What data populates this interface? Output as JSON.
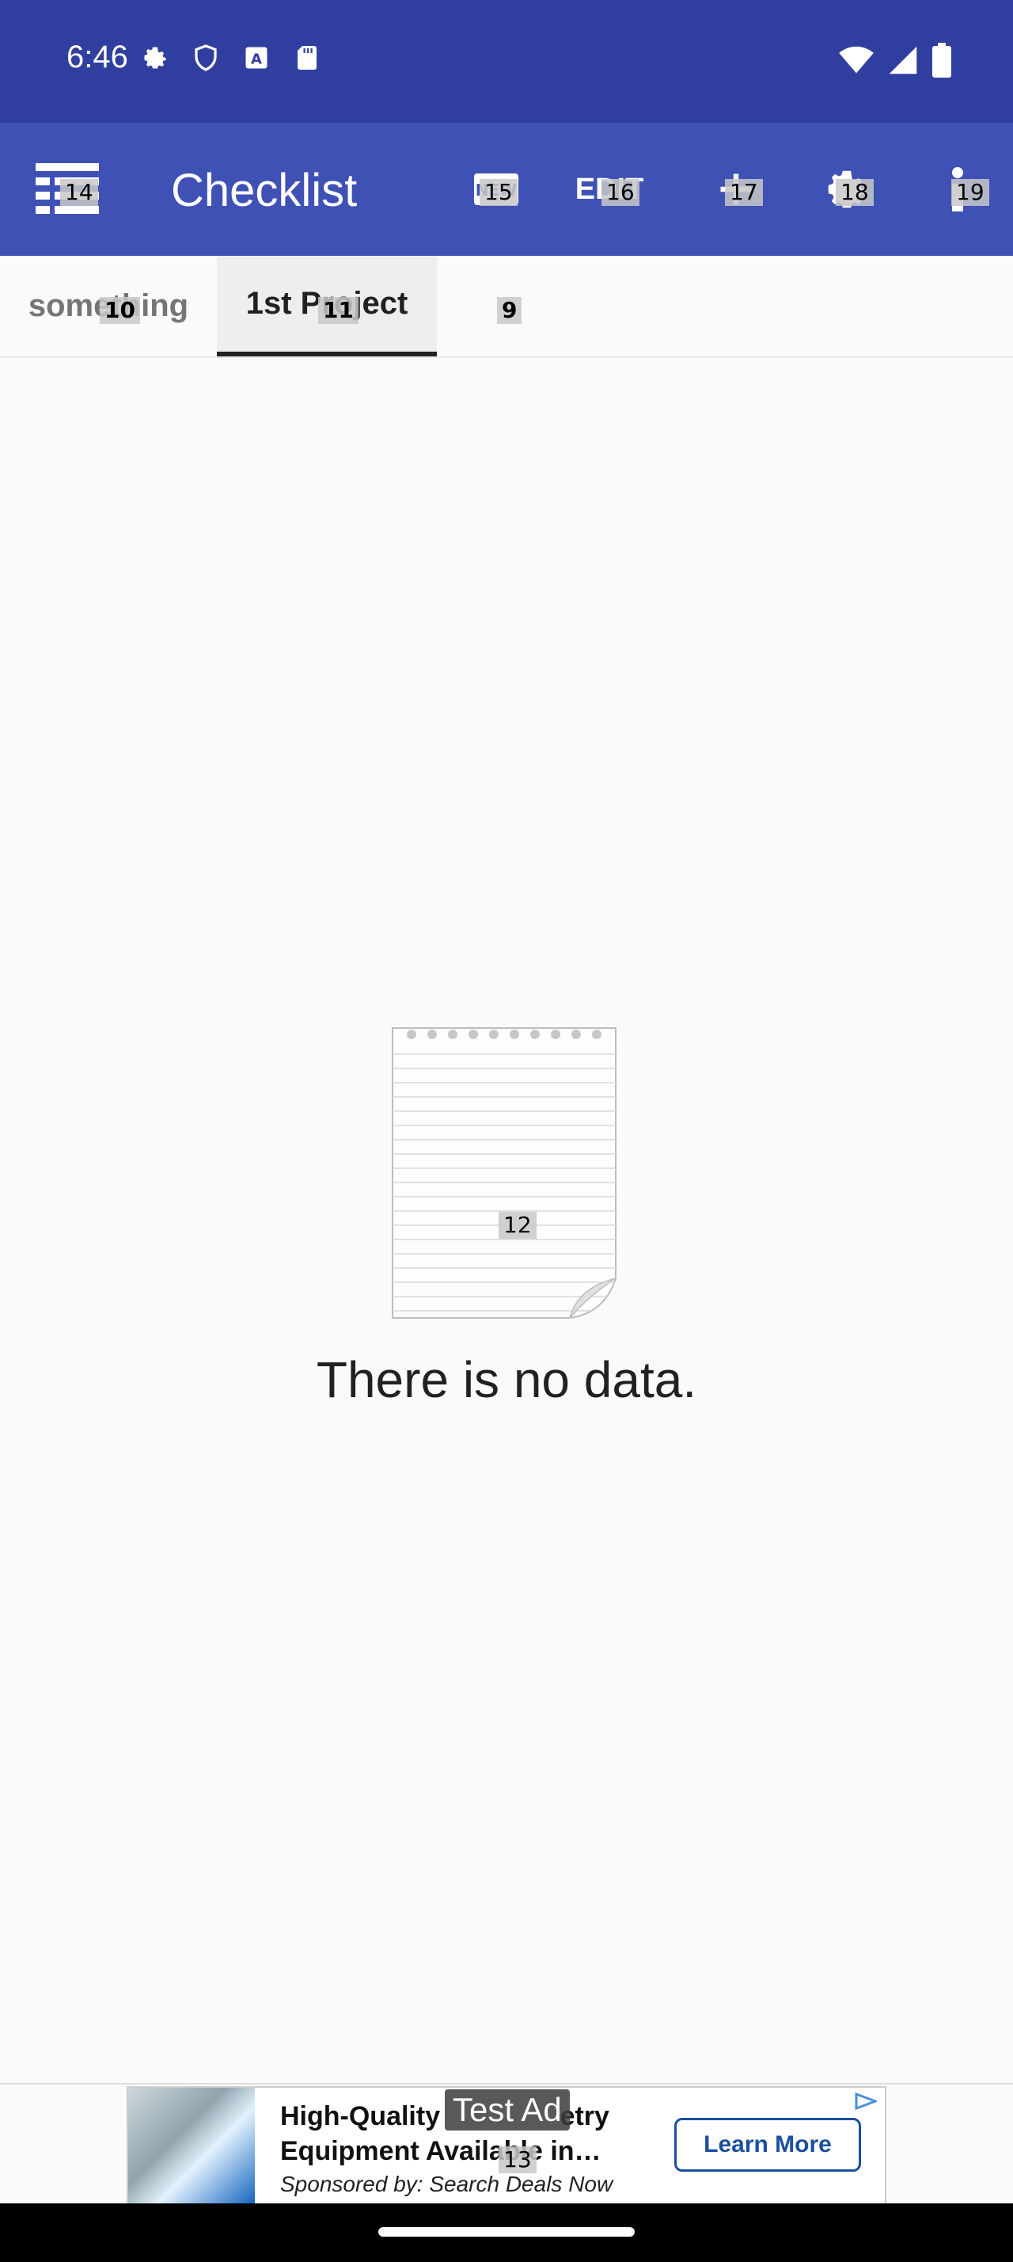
{
  "status_bar": {
    "time": "6:46"
  },
  "app_bar": {
    "title": "Checklist",
    "edit_label": "EDIT",
    "badges": {
      "menu": "14",
      "new": "15",
      "edit": "16",
      "add": "17",
      "settings": "18",
      "info": "19"
    }
  },
  "tabs": [
    {
      "label": "something",
      "badge": "10"
    },
    {
      "label": "1st Project",
      "badge": "11"
    },
    {
      "label": "",
      "badge": "9"
    }
  ],
  "empty_state": {
    "message": "There is no data.",
    "badge": "12"
  },
  "ad": {
    "title": "High-Quality Laboratory Equipment Available in…",
    "title_line1": "High-Quality",
    "title_line1b": "etry",
    "title_line2": "Equipment Available in…",
    "sponsor": "Sponsored by: Search Deals Now",
    "cta": "Learn More",
    "label": "Test Ad",
    "badge": "13"
  },
  "colors": {
    "status_bar": "#303f9f",
    "app_bar": "#3f51b5",
    "background": "#fafafa",
    "cta": "#1a4fa0"
  }
}
